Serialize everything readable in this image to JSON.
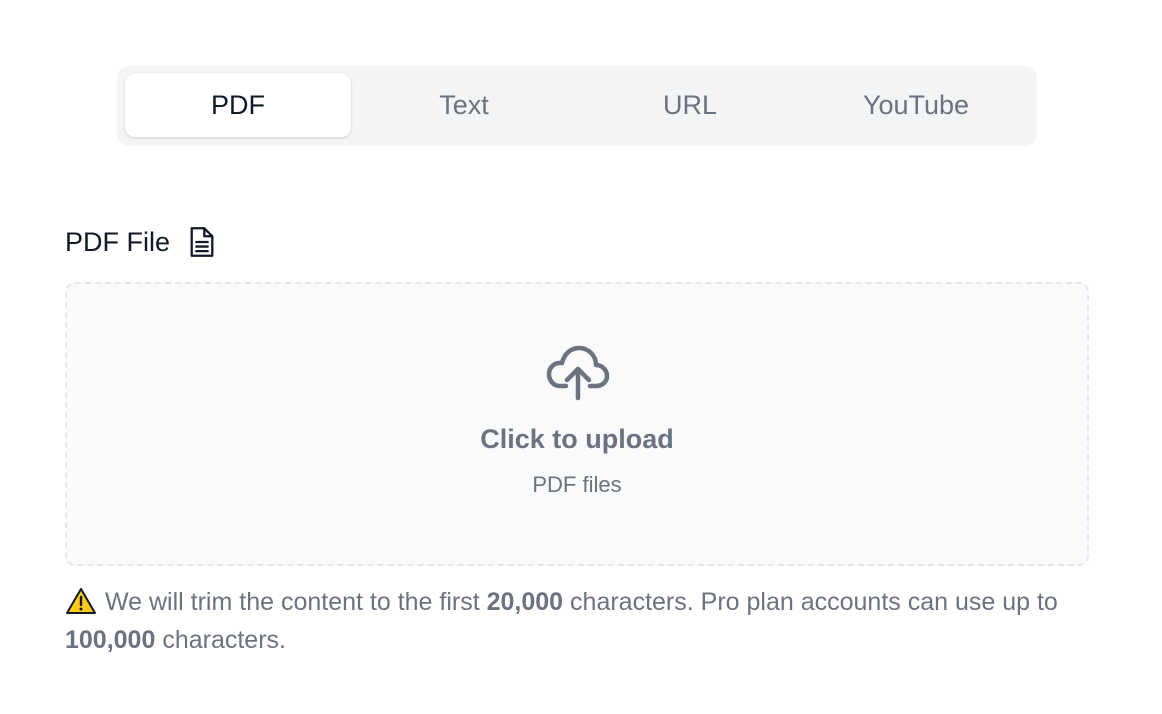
{
  "tabs": [
    {
      "label": "PDF",
      "active": true
    },
    {
      "label": "Text",
      "active": false
    },
    {
      "label": "URL",
      "active": false
    },
    {
      "label": "YouTube",
      "active": false
    }
  ],
  "field": {
    "label": "PDF File",
    "icon": "document-icon"
  },
  "dropzone": {
    "icon": "cloud-upload-icon",
    "title": "Click to upload",
    "subtitle": "PDF files"
  },
  "notice": {
    "icon": "warning-icon",
    "text_1": "We will trim the content to the first ",
    "limit_free": "20,000",
    "text_2": " characters. Pro plan accounts can use up to ",
    "limit_pro": "100,000",
    "text_3": " characters."
  },
  "colors": {
    "tab_bg": "#f3f4f6",
    "text_muted": "#6b7280",
    "text_dark": "#111827",
    "dropzone_bg": "#f9fafb",
    "dropzone_border": "#e5e7eb",
    "warning_fill": "#facc15"
  }
}
